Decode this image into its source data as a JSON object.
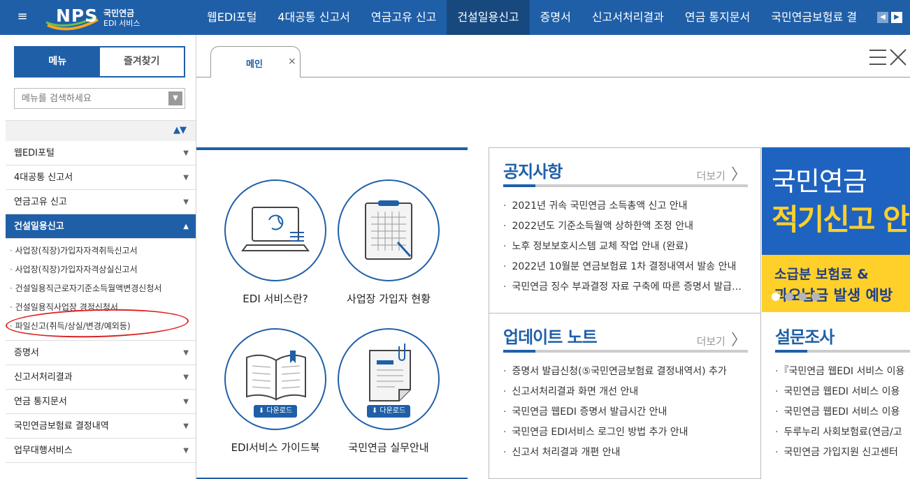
{
  "header": {
    "logo_text": "NPS",
    "logo_sub1": "국민연금",
    "logo_sub2": "EDI 서비스",
    "nav": [
      "웹EDI포털",
      "4대공통 신고서",
      "연금고유 신고",
      "건설일용신고",
      "증명서",
      "신고서처리결과",
      "연금 통지문서",
      "국민연금보험료 결"
    ],
    "active_nav": "건설일용신고"
  },
  "sidebar": {
    "tabs": [
      "메뉴",
      "즐겨찾기"
    ],
    "search_placeholder": "메뉴를 검색하세요",
    "menu": [
      {
        "label": "웹EDI포털"
      },
      {
        "label": "4대공통 신고서"
      },
      {
        "label": "연금고유 신고"
      },
      {
        "label": "건설일용신고",
        "open": true,
        "children": [
          "사업장(직장)가입자자격취득신고서",
          "사업장(직장)가입자자격상실신고서",
          "건설일용직근로자기준소득월액변경신청서",
          "건설일용직사업장 경정신청서",
          "파일신고(취득/상실/변경/예외등)"
        ]
      },
      {
        "label": "증명서"
      },
      {
        "label": "신고서처리결과"
      },
      {
        "label": "연금 통지문서"
      },
      {
        "label": "국민연금보험료 결정내역"
      },
      {
        "label": "업무대행서비스"
      }
    ]
  },
  "tabs": {
    "main_label": "메인",
    "close_glyph": "×"
  },
  "services": [
    {
      "label": "EDI 서비스란?",
      "icon": "laptop-refresh-icon"
    },
    {
      "label": "사업장 가입자 현황",
      "icon": "clipboard-grid-icon"
    },
    {
      "label": "EDI서비스 가이드북",
      "icon": "open-book-icon",
      "badge": "다운로드"
    },
    {
      "label": "국민연금 실무안내",
      "icon": "document-clip-icon",
      "badge": "다운로드"
    }
  ],
  "notice": {
    "title": "공지사항",
    "more": "더보기",
    "items": [
      "2021년 귀속 국민연금 소득총액 신고 안내",
      "2022년도 기준소득월액 상하한액 조정 안내",
      "노후 정보보호시스템 교체 작업 안내 (완료)",
      "2022년 10월분 연금보험료 1차 결정내역서 발송 안내",
      "국민연금 징수 부과결정 자료 구축에 따른 증명서 발급 안내"
    ]
  },
  "update": {
    "title": "업데이트 노트",
    "more": "더보기",
    "items": [
      "증명서 발급신청(⑤국민연금보험료 결정내역서) 추가",
      "신고서처리결과 화면 개선 안내",
      "국민연금 웹EDI 증명서 발급시간 안내",
      "국민연금 EDI서비스 로그인 방법 추가 안내",
      "신고서 처리결과 개편 안내"
    ]
  },
  "survey": {
    "title": "설문조사",
    "items": [
      "『국민연금 웹EDI 서비스 이용",
      "국민연금 웹EDI 서비스 이용",
      "국민연금 웹EDI 서비스 이용",
      "두루누리 사회보험료(연금/고",
      "국민연금 가입지원 신고센터"
    ]
  },
  "banner": {
    "line1": "국민연금",
    "line2": "적기신고 안",
    "line3": "소급분 보험료 &",
    "line4": "과오납금 발생 예방",
    "slides": 4,
    "active_slide": 0
  },
  "colors": {
    "brand": "#1f5fa8",
    "banner_blue": "#1f63c0",
    "banner_yellow": "#ffd02a",
    "annotation_red": "#d22222"
  }
}
